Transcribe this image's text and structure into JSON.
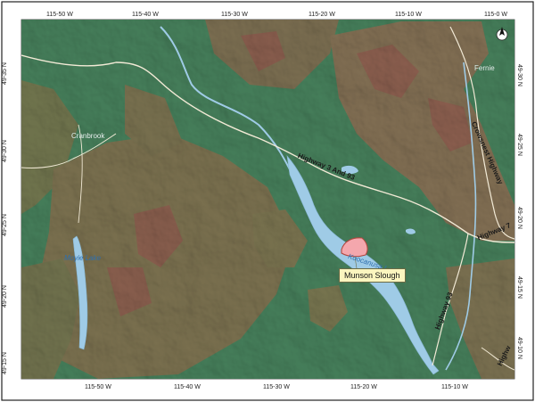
{
  "map": {
    "grid_top": [
      "115-50 W",
      "115-40 W",
      "115-30 W",
      "115-20 W",
      "115-10 W",
      "115-0 W"
    ],
    "grid_bottom": [
      "115-50 W",
      "115-40 W",
      "115-30 W",
      "115-20 W",
      "115-10 W"
    ],
    "grid_left": [
      "49-35 N",
      "49-30 N",
      "49-25 N",
      "49-20 N",
      "49-15 N"
    ],
    "grid_right": [
      "49-30 N",
      "49-25 N",
      "49-20 N",
      "49-15 N",
      "49-10 N"
    ],
    "towns": {
      "cranbrook": "Cranbrook",
      "fernie": "Fernie"
    },
    "lakes": {
      "moyie": "Moyie Lake",
      "koocanusa": "Koocanusa Lake"
    },
    "highways": {
      "hwy_3_93": "Highway 3 And 93",
      "crowsnest": "Crowsnest Highway",
      "hwy_7": "Highway 7",
      "hwy_93": "Highway 93",
      "hwy_edge": "Highw"
    },
    "site_label": "Munson Slough",
    "colors": {
      "lowland": "#5fae7c",
      "upland": "#9fa06a",
      "mountain": "#b69a72",
      "ridge": "#c07c6a",
      "water": "#9fcbe6",
      "road": "#f2ead6",
      "site": "#f4a7ad"
    },
    "icons": {
      "north_arrow": "north-arrow-icon"
    }
  }
}
